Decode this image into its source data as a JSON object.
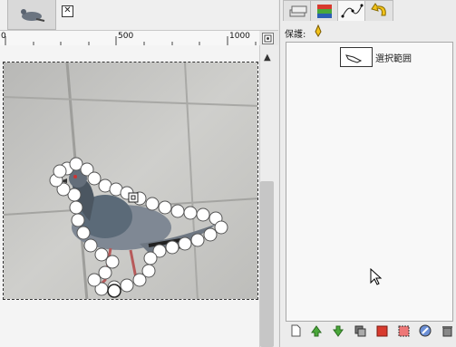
{
  "ruler": {
    "labels": [
      "0",
      "500",
      "1000"
    ]
  },
  "image_tab": {
    "close_icon": "close-icon"
  },
  "dock": {
    "tabs": [
      "layers-tab",
      "channels-tab",
      "paths-tab",
      "undo-history-tab"
    ],
    "protect_label": "保護:",
    "protect_icon": "brush-lock-icon",
    "paths": [
      {
        "name": "選択範囲"
      }
    ],
    "bottom_buttons": [
      "new-path-icon",
      "raise-path-icon",
      "lower-path-icon",
      "duplicate-path-icon",
      "path-to-selection-icon",
      "selection-to-path-icon",
      "paint-along-path-icon",
      "delete-path-icon"
    ]
  },
  "colors": {
    "accent_red": "#d83a2e",
    "accent_green": "#4aa83a",
    "yellow": "#f2c21a"
  }
}
